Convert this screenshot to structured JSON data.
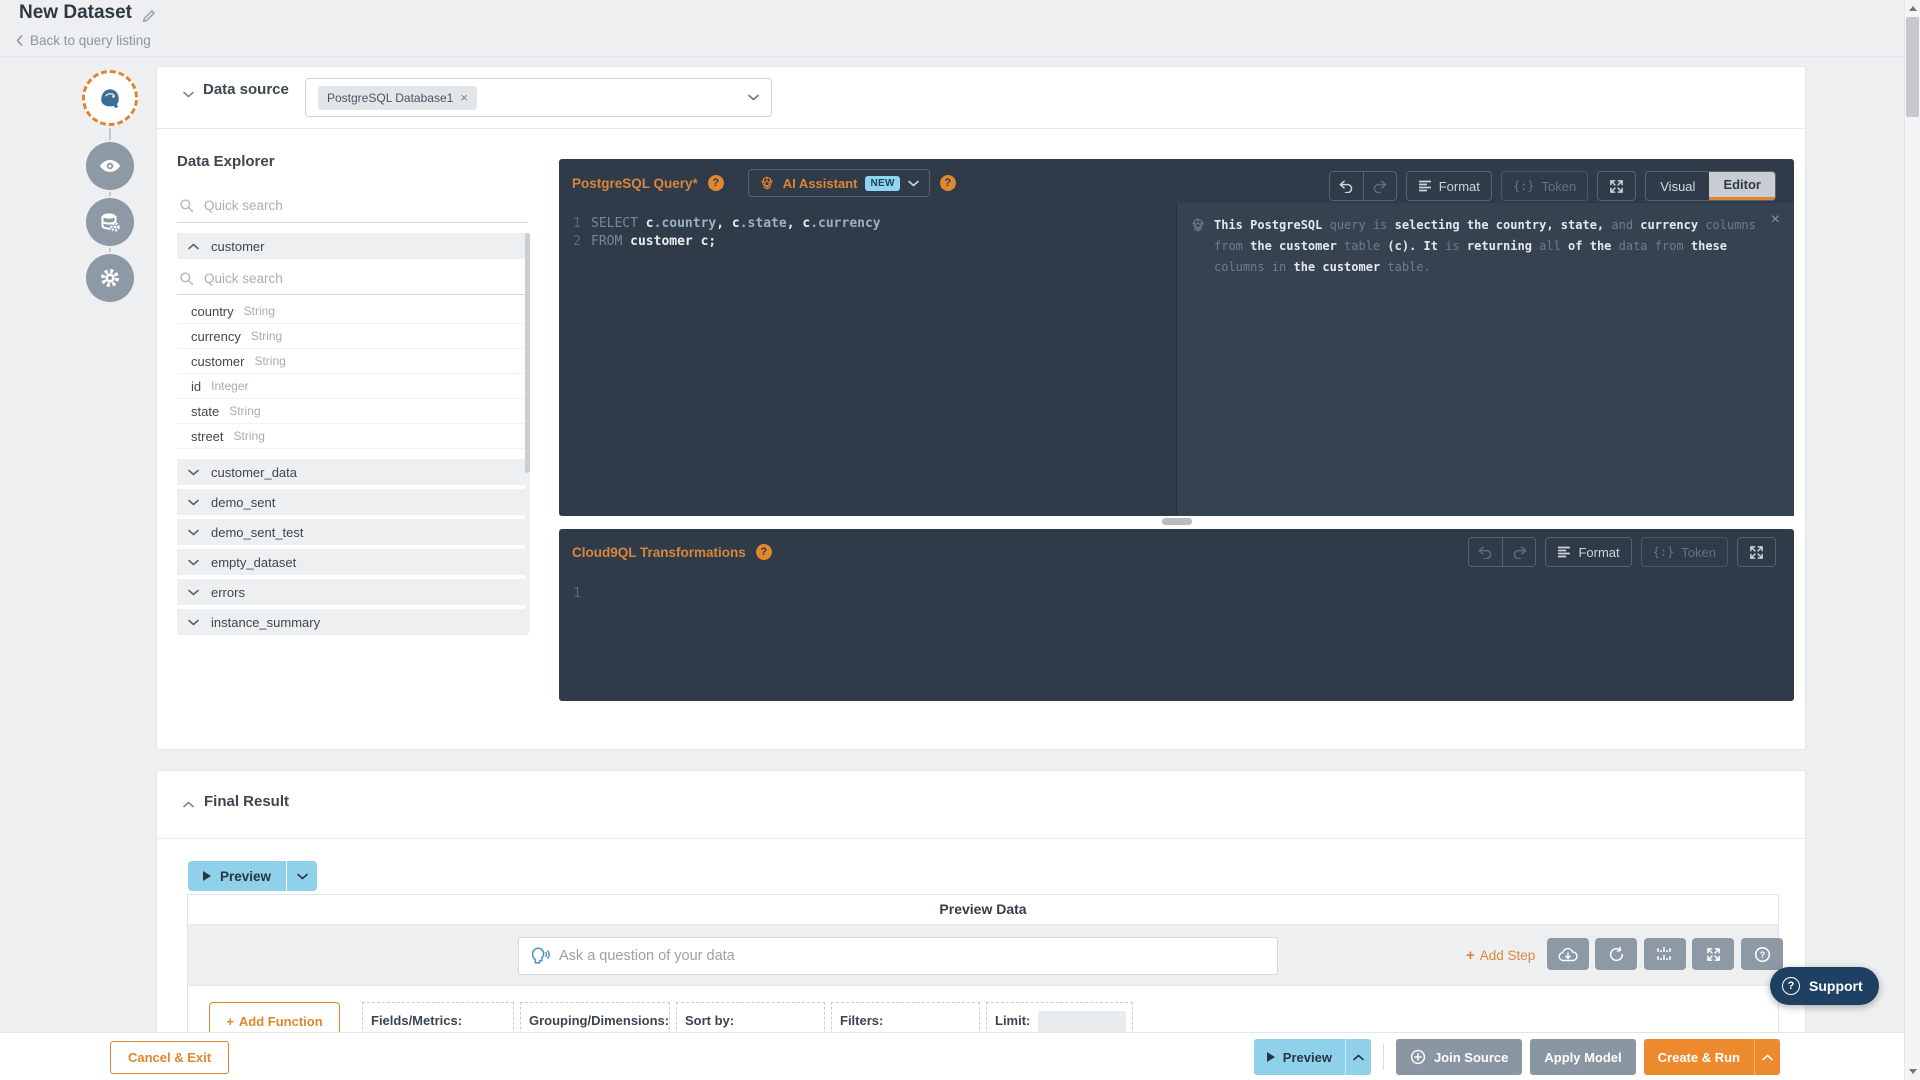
{
  "window": {
    "title": "New Dataset",
    "back_link": "Back to query listing"
  },
  "stepper": {
    "steps": [
      {
        "icon": "postgres-elephant-icon",
        "active": true
      },
      {
        "icon": "eye-icon"
      },
      {
        "icon": "database-gear-icon"
      },
      {
        "icon": "gear-icon"
      }
    ]
  },
  "data_source": {
    "label": "Data source",
    "selected_chip": "PostgreSQL Database1"
  },
  "explorer": {
    "title": "Data Explorer",
    "search_placeholder": "Quick search",
    "expanded_table": "customer",
    "inner_search_placeholder": "Quick search",
    "columns": [
      {
        "name": "country",
        "type": "String"
      },
      {
        "name": "currency",
        "type": "String"
      },
      {
        "name": "customer",
        "type": "String"
      },
      {
        "name": "id",
        "type": "Integer"
      },
      {
        "name": "state",
        "type": "String"
      },
      {
        "name": "street",
        "type": "String"
      }
    ],
    "tables": [
      "customer_data",
      "demo_sent",
      "demo_sent_test",
      "empty_dataset",
      "errors",
      "instance_summary"
    ]
  },
  "query_panel": {
    "title": "PostgreSQL Query*",
    "ai_assistant_label": "AI Assistant",
    "new_badge": "NEW",
    "format_label": "Format",
    "token_label": "Token",
    "visual_label": "Visual",
    "editor_label": "Editor",
    "code": [
      {
        "num": "1",
        "segments": [
          {
            "t": "SELECT ",
            "c": "kw"
          },
          {
            "t": "c",
            "c": "id"
          },
          {
            "t": ".country",
            "c": "fld"
          },
          {
            "t": ", ",
            "c": "id"
          },
          {
            "t": "c",
            "c": "id"
          },
          {
            "t": ".state",
            "c": "fld"
          },
          {
            "t": ", ",
            "c": "id"
          },
          {
            "t": "c",
            "c": "id"
          },
          {
            "t": ".currency",
            "c": "fld"
          }
        ]
      },
      {
        "num": "2",
        "segments": [
          {
            "t": "FROM ",
            "c": "kw"
          },
          {
            "t": "customer c;",
            "c": "id"
          }
        ]
      }
    ],
    "ai_explanation": [
      {
        "t": "This PostgreSQL ",
        "b": true
      },
      {
        "t": "query is ",
        "b": false
      },
      {
        "t": "selecting the country, state, ",
        "b": true
      },
      {
        "t": "and ",
        "b": false
      },
      {
        "t": "currency ",
        "b": true
      },
      {
        "t": "columns from ",
        "b": false
      },
      {
        "t": "the customer ",
        "b": true
      },
      {
        "t": "table ",
        "b": false
      },
      {
        "t": "(c). It ",
        "b": true
      },
      {
        "t": "is ",
        "b": false
      },
      {
        "t": "returning ",
        "b": true
      },
      {
        "t": "all ",
        "b": false
      },
      {
        "t": "of the ",
        "b": true
      },
      {
        "t": "data from ",
        "b": false
      },
      {
        "t": "these ",
        "b": true
      },
      {
        "t": "columns in ",
        "b": false
      },
      {
        "t": "the customer ",
        "b": true
      },
      {
        "t": "table.",
        "b": false
      }
    ]
  },
  "transform_panel": {
    "title": "Cloud9QL Transformations",
    "format_label": "Format",
    "token_label": "Token",
    "line_numbers": [
      "1"
    ]
  },
  "final_result": {
    "title": "Final Result",
    "preview_button": "Preview",
    "panel_title": "Preview Data",
    "ask_placeholder": "Ask a question of your data",
    "add_step_label": "Add Step",
    "toolbar_icons": [
      "cloud-download-icon",
      "refresh-icon",
      "chart-icon",
      "expand-icon",
      "help-icon"
    ],
    "add_function_label": "Add Function",
    "slots": [
      {
        "label": "Fields/Metrics:"
      },
      {
        "label": "Grouping/Dimensions:"
      },
      {
        "label": "Sort by:"
      },
      {
        "label": "Filters:"
      },
      {
        "label": "Limit:",
        "has_field": true
      }
    ]
  },
  "footer": {
    "cancel_label": "Cancel & Exit",
    "preview_label": "Preview",
    "join_source_label": "Join Source",
    "apply_model_label": "Apply Model",
    "create_run_label": "Create & Run"
  },
  "support": {
    "label": "Support"
  },
  "colors": {
    "accent_orange": "#e0862f",
    "button_orange": "#ed8a2e",
    "light_blue": "#8fd0ea",
    "new_badge_blue": "#8ed5ef",
    "panel_dark": "#2f3b49",
    "panel_dark_alt": "#36424f",
    "gray_button": "#8a97a2"
  }
}
